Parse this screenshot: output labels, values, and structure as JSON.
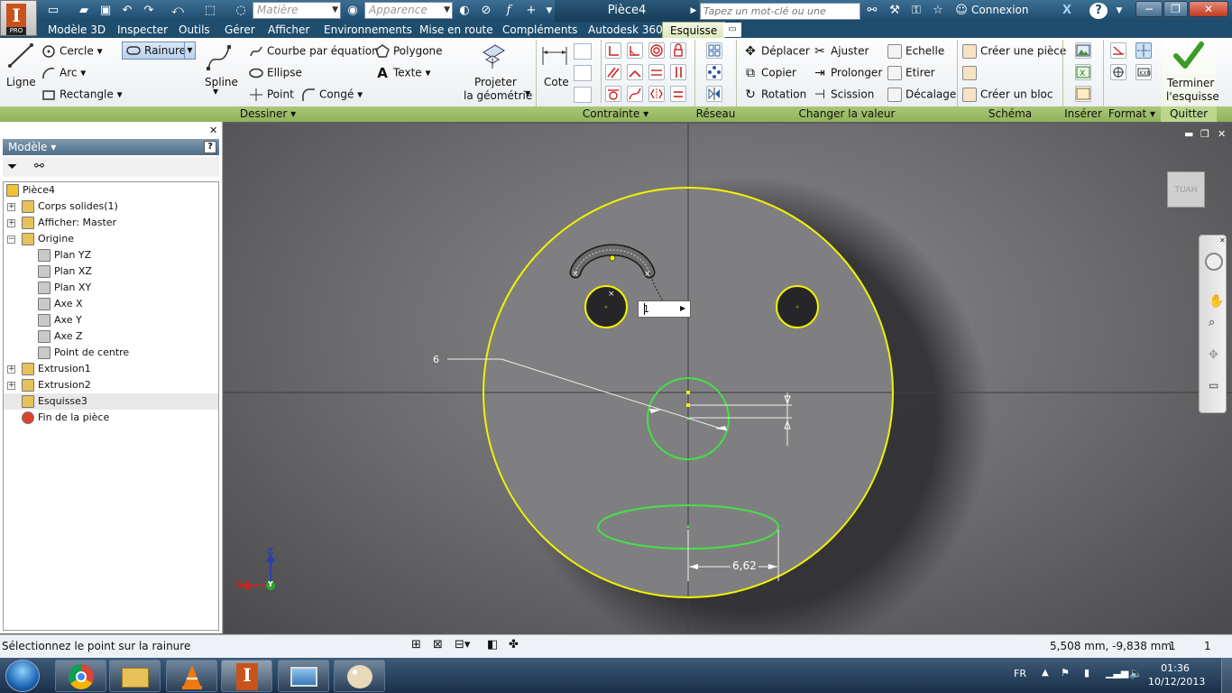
{
  "title_bar": {
    "material_placeholder": "Matière",
    "appearance_placeholder": "Apparence",
    "document_title": "Pièce4",
    "search_placeholder": "Tapez un mot-clé ou une expression",
    "login_label": "Connexion",
    "help_label": "?"
  },
  "ribbon_tabs": [
    "Modèle 3D",
    "Inspecter",
    "Outils",
    "Gérer",
    "Afficher",
    "Environnements",
    "Mise en route",
    "Compléments",
    "Autodesk 360",
    "Esquisse"
  ],
  "active_tab": "Esquisse",
  "ribbon": {
    "dessiner": {
      "ligne": "Ligne",
      "cercle": "Cercle",
      "arc": "Arc",
      "rectangle": "Rectangle",
      "rainure": "Rainure",
      "spline": "Spline",
      "courbe": "Courbe par équation",
      "ellipse": "Ellipse",
      "point": "Point",
      "polygone": "Polygone",
      "texte": "Texte",
      "conge": "Congé",
      "projeter_1": "Projeter",
      "projeter_2": "la géométrie"
    },
    "contrainte": {
      "cote": "Cote"
    },
    "modifier": {
      "deplacer": "Déplacer",
      "copier": "Copier",
      "rotation": "Rotation",
      "ajuster": "Ajuster",
      "prolonger": "Prolonger",
      "scission": "Scission",
      "echelle": "Echelle",
      "etirer": "Etirer",
      "decalage": "Décalage"
    },
    "schema": {
      "creer_piece": "Créer une pièce",
      "creer_bloc": "Créer un bloc"
    },
    "terminer_1": "Terminer",
    "terminer_2": "l'esquisse",
    "panels": {
      "dessiner": "Dessiner",
      "contrainte": "Contrainte",
      "reseau": "Réseau",
      "changer": "Changer la valeur",
      "schema": "Schéma",
      "inserer": "Insérer",
      "format": "Format",
      "quitter": "Quitter"
    }
  },
  "browser": {
    "header": "Modèle",
    "tree": [
      {
        "label": "Pièce4",
        "level": 0,
        "expander": ""
      },
      {
        "label": "Corps solides(1)",
        "level": 1,
        "expander": "+"
      },
      {
        "label": "Afficher: Master",
        "level": 1,
        "expander": "+"
      },
      {
        "label": "Origine",
        "level": 1,
        "expander": "−"
      },
      {
        "label": "Plan YZ",
        "level": 2,
        "expander": ""
      },
      {
        "label": "Plan XZ",
        "level": 2,
        "expander": ""
      },
      {
        "label": "Plan XY",
        "level": 2,
        "expander": ""
      },
      {
        "label": "Axe X",
        "level": 2,
        "expander": ""
      },
      {
        "label": "Axe Y",
        "level": 2,
        "expander": ""
      },
      {
        "label": "Axe Z",
        "level": 2,
        "expander": ""
      },
      {
        "label": "Point de centre",
        "level": 2,
        "expander": ""
      },
      {
        "label": "Extrusion1",
        "level": 1,
        "expander": "+"
      },
      {
        "label": "Extrusion2",
        "level": 1,
        "expander": "+"
      },
      {
        "label": "Esquisse3",
        "level": 1,
        "expander": ""
      },
      {
        "label": "Fin de la pièce",
        "level": 1,
        "expander": ""
      }
    ]
  },
  "viewport": {
    "viewcube_label": "HAUT",
    "dim_leader": "6",
    "dim_ellipse": "6,62",
    "input_value": "1",
    "axis_x": "X",
    "axis_y": "Y",
    "axis_z": "Z"
  },
  "status_bar": {
    "message": "Sélectionnez le point sur la rainure",
    "coordinates": "5,508 mm, -9,838 mm",
    "count_1": "1",
    "count_2": "1"
  },
  "taskbar": {
    "lang": "FR",
    "time": "01:36",
    "date": "10/12/2013"
  },
  "colors": {
    "sketch_yellow": "#f2f200",
    "sketch_green": "#46e046",
    "ribbon_green": "#a9c878",
    "titlebar_blue": "#1d4a6d"
  }
}
